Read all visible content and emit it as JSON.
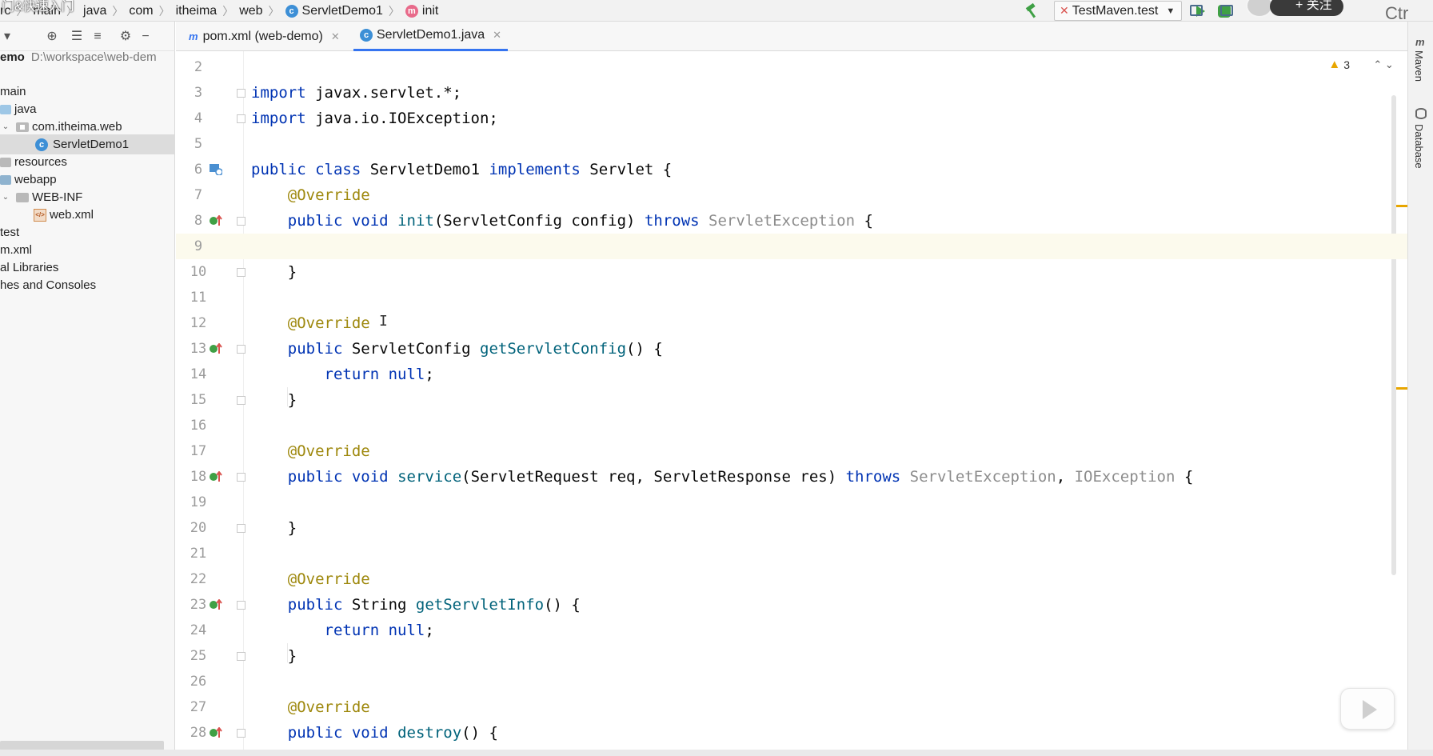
{
  "colors": {
    "keyword": "#0033b3",
    "annotation": "#9e880d",
    "method": "#00627a",
    "grey_type": "#8c8c8c",
    "accent": "#3574f0",
    "run_green": "#3fa045",
    "warning": "#e8a600"
  },
  "overlay": {
    "text": "门&快速入门"
  },
  "breadcrumb": {
    "items": [
      "rc",
      "main",
      "java",
      "com",
      "itheima",
      "web",
      "ServletDemo1",
      "init"
    ],
    "icons": [
      "class-icon",
      "method-icon"
    ]
  },
  "run": {
    "config": "TestMaven.test",
    "follow_label": "+ 关注",
    "corner_text": "Ctr"
  },
  "sidebar": {
    "tree": [
      {
        "label": "emo",
        "path": "D:\\workspace\\web-dem",
        "bold": true
      },
      {
        "label": "main"
      },
      {
        "label": "java"
      },
      {
        "label": "com.itheima.web"
      },
      {
        "label": "ServletDemo1",
        "selected": true
      },
      {
        "label": "resources"
      },
      {
        "label": "webapp"
      },
      {
        "label": "WEB-INF"
      },
      {
        "label": "web.xml"
      },
      {
        "label": "test"
      },
      {
        "label": "m.xml"
      },
      {
        "label": "al Libraries"
      },
      {
        "label": "hes and Consoles"
      }
    ]
  },
  "tabs": [
    {
      "label": "pom.xml (web-demo)",
      "active": false
    },
    {
      "label": "ServletDemo1.java",
      "active": true
    }
  ],
  "editor": {
    "warnings": "3",
    "current_line": 9,
    "lines": [
      {
        "n": "2"
      },
      {
        "n": "3"
      },
      {
        "n": "4"
      },
      {
        "n": "5"
      },
      {
        "n": "6"
      },
      {
        "n": "7"
      },
      {
        "n": "8"
      },
      {
        "n": "9"
      },
      {
        "n": "10"
      },
      {
        "n": "11"
      },
      {
        "n": "12"
      },
      {
        "n": "13"
      },
      {
        "n": "14"
      },
      {
        "n": "15"
      },
      {
        "n": "16"
      },
      {
        "n": "17"
      },
      {
        "n": "18"
      },
      {
        "n": "19"
      },
      {
        "n": "20"
      },
      {
        "n": "21"
      },
      {
        "n": "22"
      },
      {
        "n": "23"
      },
      {
        "n": "24"
      },
      {
        "n": "25"
      },
      {
        "n": "26"
      },
      {
        "n": "27"
      },
      {
        "n": "28"
      }
    ],
    "code": {
      "l3_kw": "import",
      "l3_rest": " javax.servlet.*;",
      "l4_kw": "import",
      "l4_rest": " java.io.IOException;",
      "l6_kw1": "public",
      "l6_kw2": "class",
      "l6_name": " ServletDemo1 ",
      "l6_kw3": "implements",
      "l6_rest": " Servlet {",
      "override": "@Override",
      "l8_kw1": "public",
      "l8_kw2": "void",
      "l8_fn": "init",
      "l8_args": "(ServletConfig config) ",
      "l8_throws": "throws",
      "l8_ex": " ServletException",
      "l8_end": " {",
      "close_brace": "}",
      "l13_kw1": "public",
      "l13_type": " ServletConfig ",
      "l13_fn": "getServletConfig",
      "l13_end": "() {",
      "ret_kw": "return",
      "ret_null": "null",
      "ret_end": ";",
      "l18_kw1": "public",
      "l18_kw2": "void",
      "l18_fn": "service",
      "l18_args": "(ServletRequest req, ServletResponse res) ",
      "l18_throws": "throws",
      "l18_ex1": " ServletException",
      "l18_comma": ",",
      "l18_ex2": " IOException",
      "l18_end": " {",
      "l23_kw1": "public",
      "l23_type": " String ",
      "l23_fn": "getServletInfo",
      "l23_end": "() {",
      "l28_kw1": "public",
      "l28_kw2": "void",
      "l28_fn": "destroy",
      "l28_end": "() {"
    }
  },
  "right_tools": [
    "Maven",
    "Database"
  ]
}
